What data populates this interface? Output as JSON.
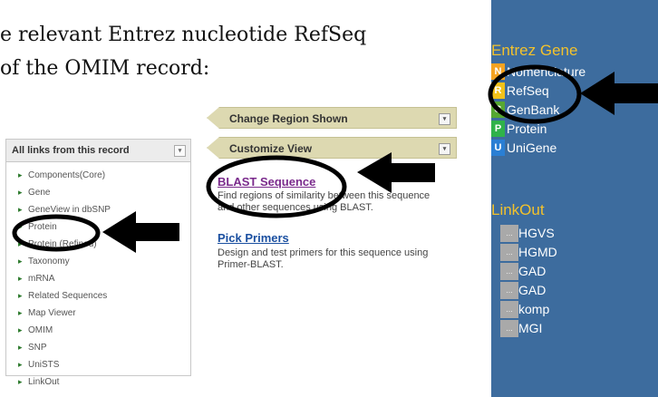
{
  "intro": {
    "line1": "e relevant Entrez nucleotide RefSeq",
    "line2": "of the OMIM record:"
  },
  "links_panel": {
    "header": "All links from this record",
    "items": [
      "Components(Core)",
      "Gene",
      "GeneView in dbSNP",
      "Protein",
      "Protein (Refined)",
      "Taxonomy",
      "mRNA",
      "Related Sequences",
      "Map Viewer",
      "OMIM",
      "SNP",
      "UniSTS",
      "LinkOut"
    ]
  },
  "bars": {
    "change_region": "Change Region Shown",
    "customize_view": "Customize View"
  },
  "tools": {
    "blast_title": "BLAST Sequence",
    "blast_desc1": "Find regions of similarity between this sequence",
    "blast_desc2": "and other sequences using BLAST.",
    "primers_title": "Pick Primers",
    "primers_desc1": "Design and test primers for this sequence using",
    "primers_desc2": "Primer-BLAST."
  },
  "entrez_gene": {
    "title": "Entrez Gene",
    "items": [
      {
        "letter": "N",
        "label": "Nomenclature",
        "color": "#f5a321"
      },
      {
        "letter": "R",
        "label": "RefSeq",
        "color": "#f2c21a"
      },
      {
        "letter": "G",
        "label": "GenBank",
        "color": "#56a832"
      },
      {
        "letter": "P",
        "label": "Protein",
        "color": "#2fb24a"
      },
      {
        "letter": "U",
        "label": "UniGene",
        "color": "#2a7fd4"
      }
    ]
  },
  "linkout": {
    "title": "LinkOut",
    "box_glyph": "...",
    "items": [
      "HGVS",
      "HGMD",
      "GAD",
      "GAD",
      "komp",
      "MGI"
    ]
  },
  "colors": {
    "sidebar_bg": "#3d6c9e",
    "sidebar_title": "#f3c22c",
    "bar_bg": "#ddd9b1",
    "blast_link": "#7a2a8c",
    "primers_link": "#1a4fa0"
  }
}
